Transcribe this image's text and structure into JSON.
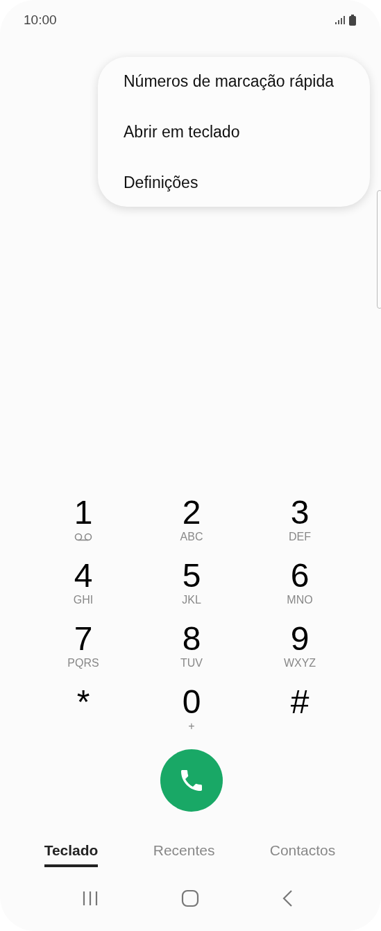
{
  "status_bar": {
    "time": "10:00"
  },
  "menu": {
    "items": [
      {
        "label": "Números de marcação rápida"
      },
      {
        "label": "Abrir em teclado"
      },
      {
        "label": "Definições"
      }
    ]
  },
  "keypad": {
    "keys": [
      {
        "kind": "voicemail",
        "digit": "1"
      },
      {
        "kind": "letters",
        "digit": "2",
        "sub": "ABC"
      },
      {
        "kind": "letters",
        "digit": "3",
        "sub": "DEF"
      },
      {
        "kind": "letters",
        "digit": "4",
        "sub": "GHI"
      },
      {
        "kind": "letters",
        "digit": "5",
        "sub": "JKL"
      },
      {
        "kind": "letters",
        "digit": "6",
        "sub": "MNO"
      },
      {
        "kind": "letters",
        "digit": "7",
        "sub": "PQRS"
      },
      {
        "kind": "letters",
        "digit": "8",
        "sub": "TUV"
      },
      {
        "kind": "letters",
        "digit": "9",
        "sub": "WXYZ"
      },
      {
        "kind": "plain",
        "digit": "*"
      },
      {
        "kind": "letters",
        "digit": "0",
        "sub": "+"
      },
      {
        "kind": "plain",
        "digit": "#"
      }
    ]
  },
  "tabs": [
    {
      "label": "Teclado",
      "selected": true
    },
    {
      "label": "Recentes",
      "selected": false
    },
    {
      "label": "Contactos",
      "selected": false
    }
  ]
}
